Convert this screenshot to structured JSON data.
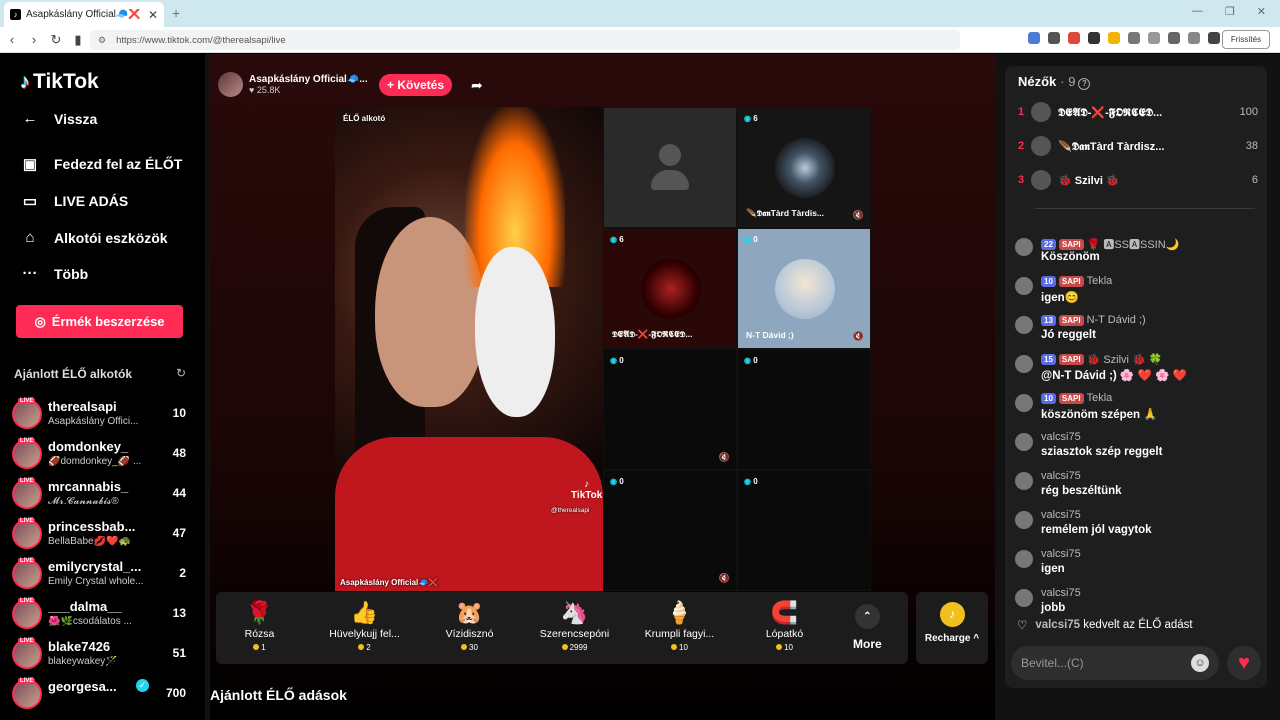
{
  "browser": {
    "tab_title": "Asapkáslány Official🧢❌ (@",
    "tab_close": "✕",
    "new_tab": "+",
    "url": "https://www.tiktok.com/@therealsapi/live",
    "refresh_label": "Frissítés"
  },
  "logo": "TikTok",
  "nav": {
    "back": "Vissza",
    "explore": "Fedezd fel az ÉLŐT",
    "live": "LIVE ADÁS",
    "creator_tools": "Alkotói eszközök",
    "more": "Több"
  },
  "coins_button": "Érmék beszerzése",
  "recommended_title": "Ajánlott ÉLŐ alkotók",
  "creators": [
    {
      "name": "therealsapi",
      "sub": "Asapkáslány Offici...",
      "count": "10"
    },
    {
      "name": "domdonkey_",
      "sub": "🏈domdonkey_🏈 ...",
      "count": "48"
    },
    {
      "name": "mrcannabis_",
      "sub": "𝓜𝓻.𝓒𝓪𝓷𝓷𝓪𝓫𝓲𝓼®",
      "count": "44"
    },
    {
      "name": "princessbab...",
      "sub": "BellaBabe💋❤️🐢",
      "count": "47"
    },
    {
      "name": "emilycrystal_...",
      "sub": "Emily Crystal whole...",
      "count": "2"
    },
    {
      "name": "___dalma__",
      "sub": "🌺🌿csodálatos ...",
      "count": "13"
    },
    {
      "name": "blake7426",
      "sub": "blakeywakey🪄",
      "count": "51"
    },
    {
      "name": "georgesa...",
      "sub": "",
      "count": "700"
    }
  ],
  "host": {
    "name": "Asapkáslány Official🧢...",
    "likes": "25.8K"
  },
  "follow_button": "+ Követés",
  "stage": {
    "main_tag": "ÉLŐ alkotó",
    "main_name": "Asapkáslány Official🧢❌",
    "watermark": "TikTok",
    "watermark_handle": "@therealsapi",
    "guests": [
      {
        "views": "",
        "name": ""
      },
      {
        "views": "6",
        "name": "🪶𝕯𝖆𝖓Tàrd Tàrdis..."
      },
      {
        "views": "6",
        "name": "𝕯𝕰𝕬𝕯-❌-𝕱𝕺𝕽𝕮𝕰𝕯..."
      },
      {
        "views": "0",
        "name": "N-T Dávid ;)"
      },
      {
        "views": "0",
        "name": ""
      },
      {
        "views": "0",
        "name": ""
      },
      {
        "views": "0",
        "name": ""
      },
      {
        "views": "0",
        "name": ""
      }
    ]
  },
  "gifts": [
    {
      "name": "Rózsa",
      "price": "1",
      "icon": "🌹"
    },
    {
      "name": "Hüvelykujj fel...",
      "price": "2",
      "icon": "👍"
    },
    {
      "name": "Vízidisznó",
      "price": "30",
      "icon": "🐹"
    },
    {
      "name": "Szerencsepóni",
      "price": "2999",
      "icon": "🦄"
    },
    {
      "name": "Krumpli fagyi...",
      "price": "10",
      "icon": "🍦"
    },
    {
      "name": "Lópatkó",
      "price": "10",
      "icon": "🧲"
    }
  ],
  "more_label": "More",
  "recharge_label": "Recharge ^",
  "recommended_lives": "Ajánlott ÉLŐ adások",
  "viewers": {
    "title": "Nézők",
    "count": "· 9"
  },
  "ranking": [
    {
      "rank": "1",
      "name": "𝕯𝕰𝕬𝕯-❌-𝕱𝕺𝕽𝕮𝕰𝕯...",
      "score": "100"
    },
    {
      "rank": "2",
      "name": "🪶𝕯𝖆𝖓Tàrd Tàrdisz...",
      "score": "38"
    },
    {
      "rank": "3",
      "name": "🐞 Szilvi 🐞",
      "score": "6"
    }
  ],
  "chat": [
    {
      "user": "🌹 🅰SS🅰SSIN🌙",
      "level": "22",
      "fan": "SAPI",
      "text": "Köszönöm"
    },
    {
      "user": "Tekla",
      "level": "10",
      "fan": "SAPI",
      "text": "igen😊"
    },
    {
      "user": "N-T Dávid ;)",
      "level": "13",
      "fan": "SAPI",
      "text": "Jó reggelt"
    },
    {
      "user": "🐞 Szilvi 🐞 🍀",
      "level": "15",
      "fan": "SAPI",
      "text": "@N-T Dávid ;) 🌸 ❤️ 🌸 ❤️"
    },
    {
      "user": "Tekla",
      "level": "10",
      "fan": "SAPI",
      "text": "köszönöm szépen 🙏"
    },
    {
      "user": "valcsi75",
      "level": "",
      "fan": "",
      "text": "sziasztok szép reggelt"
    },
    {
      "user": "valcsi75",
      "level": "",
      "fan": "",
      "text": "rég beszéltünk"
    },
    {
      "user": "valcsi75",
      "level": "",
      "fan": "",
      "text": "remélem jól vagytok"
    },
    {
      "user": "valcsi75",
      "level": "",
      "fan": "",
      "text": "igen"
    },
    {
      "user": "valcsi75",
      "level": "",
      "fan": "",
      "text": "jobb"
    }
  ],
  "like_event": {
    "user": "valcsi75",
    "text": "kedvelt az ÉLŐ adást"
  },
  "chat_input_placeholder": "Bevitel...(C)",
  "colors": {
    "accent": "#fe2c55",
    "coin": "#f2c01c",
    "level_badge": "#5b6be8"
  }
}
